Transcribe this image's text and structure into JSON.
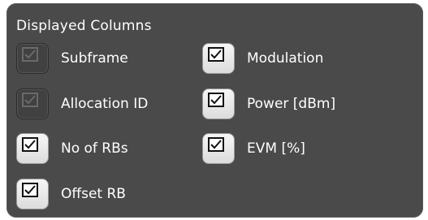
{
  "dialog": {
    "section_title": "Displayed Columns"
  },
  "options": {
    "subframe": {
      "label": "Subframe",
      "checked": true,
      "enabled": false
    },
    "allocation_id": {
      "label": "Allocation ID",
      "checked": true,
      "enabled": false
    },
    "no_of_rbs": {
      "label": "No of RBs",
      "checked": true,
      "enabled": true
    },
    "offset_rb": {
      "label": "Offset RB",
      "checked": true,
      "enabled": true
    },
    "modulation": {
      "label": "Modulation",
      "checked": true,
      "enabled": true
    },
    "power": {
      "label": "Power [dBm]",
      "checked": true,
      "enabled": true
    },
    "evm": {
      "label": "EVM [%]",
      "checked": true,
      "enabled": true
    }
  },
  "colors": {
    "panel_background": "#4a4a4a",
    "label_text": "#ffffff",
    "checkbox_enabled": "#ececec",
    "checkbox_disabled": "#414141"
  },
  "icons": {
    "check": "checkmark-icon"
  }
}
